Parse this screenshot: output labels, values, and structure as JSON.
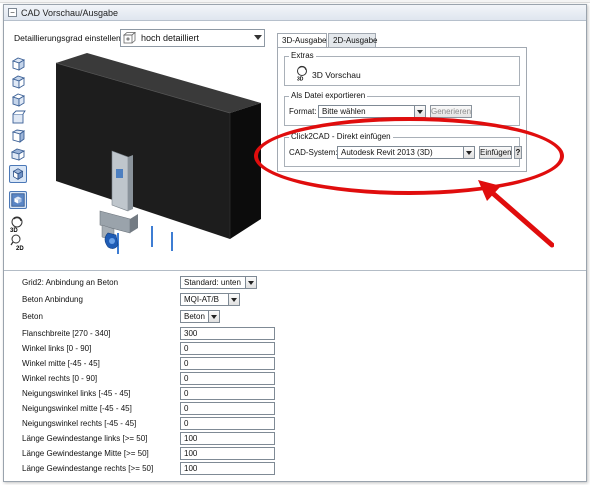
{
  "panel": {
    "title": "CAD Vorschau/Ausgabe",
    "collapse_symbol": "−"
  },
  "detail": {
    "label": "Detaillierungsgrad einstellen",
    "value": "hoch detailliert"
  },
  "toolbar_icons": [
    "cube-front-icon",
    "cube-iso-icon",
    "cube-side-icon",
    "cube-top-icon",
    "cube-iso2-icon",
    "cube-iso3-icon",
    "cube-shaded-icon",
    "render-icon",
    "rotate-3d-icon",
    "view-2d-icon"
  ],
  "toolbar_labels": {
    "rotate_3d": "3D",
    "view_2d": "2D"
  },
  "tabs": [
    {
      "label": "3D-Ausgabe",
      "active": true
    },
    {
      "label": "2D-Ausgabe",
      "active": false
    }
  ],
  "extras": {
    "legend": "Extras",
    "preview_label": "3D Vorschau",
    "preview_icon": "3D"
  },
  "export": {
    "legend": "Als Datei exportieren",
    "format_label": "Format:",
    "format_value": "Bitte wählen",
    "button": "Generieren"
  },
  "click2cad": {
    "legend": "Click2CAD - Direkt einfügen",
    "system_label": "CAD-System:",
    "system_value": "Autodesk Revit 2013 (3D)",
    "button": "Einfügen",
    "help": "?"
  },
  "properties": [
    {
      "label": "Grid2: Anbindung an Beton",
      "type": "select",
      "value": "Standard: unten"
    },
    {
      "label": "Beton Anbindung",
      "type": "select",
      "value": "MQI-AT/B"
    },
    {
      "label": "Beton",
      "type": "select",
      "value": "Beton"
    },
    {
      "label": "Flanschbreite [270 - 340]",
      "type": "input",
      "value": "300"
    },
    {
      "label": "Winkel links [0 - 90]",
      "type": "input",
      "value": "0"
    },
    {
      "label": "Winkel mitte [-45 - 45]",
      "type": "input",
      "value": "0"
    },
    {
      "label": "Winkel rechts [0 - 90]",
      "type": "input",
      "value": "0"
    },
    {
      "label": "Neigungswinkel links [-45 - 45]",
      "type": "input",
      "value": "0"
    },
    {
      "label": "Neigungswinkel mitte [-45 - 45]",
      "type": "input",
      "value": "0"
    },
    {
      "label": "Neigungswinkel rechts [-45 - 45]",
      "type": "input",
      "value": "0"
    },
    {
      "label": "Länge Gewindestange links [>= 50]",
      "type": "input",
      "value": "100"
    },
    {
      "label": "Länge Gewindestange Mitte [>= 50]",
      "type": "input",
      "value": "100"
    },
    {
      "label": "Länge Gewindestange rechts [>= 50]",
      "type": "input",
      "value": "100"
    }
  ],
  "colors": {
    "annotation_red": "#e00d0d",
    "concrete_block": "#1d1d1d",
    "selected_tool": "#d9e6f6"
  }
}
